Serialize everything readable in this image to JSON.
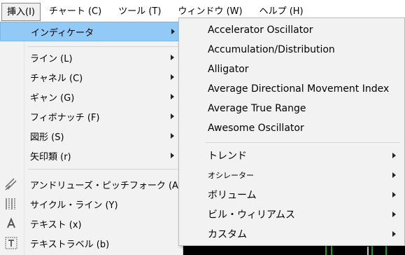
{
  "menubar": {
    "items": [
      {
        "label": "挿入(I)",
        "name": "menu-insert"
      },
      {
        "label": "チャート (C)",
        "name": "menu-chart"
      },
      {
        "label": "ツール (T)",
        "name": "menu-tools"
      },
      {
        "label": "ウィンドウ (W)",
        "name": "menu-window"
      },
      {
        "label": "ヘルプ (H)",
        "name": "menu-help"
      }
    ]
  },
  "insert_menu": {
    "indicators": "インディケータ",
    "items": [
      {
        "label": "ライン (L)"
      },
      {
        "label": "チャネル (C)"
      },
      {
        "label": "ギャン (G)"
      },
      {
        "label": "フィボナッチ (F)"
      },
      {
        "label": "図形 (S)"
      },
      {
        "label": "矢印類 (r)"
      }
    ],
    "tools": [
      {
        "label": "アンドリューズ・ピッチフォーク (A)",
        "icon": "pitchfork-icon"
      },
      {
        "label": "サイクル・ライン (Y)",
        "icon": "cycle-lines-icon"
      },
      {
        "label": "テキスト (x)",
        "icon": "text-icon"
      },
      {
        "label": "テキストラベル (b)",
        "icon": "text-label-icon"
      }
    ]
  },
  "indicators_submenu": {
    "items": [
      {
        "label": "Accelerator Oscillator"
      },
      {
        "label": "Accumulation/Distribution"
      },
      {
        "label": "Alligator"
      },
      {
        "label": "Average Directional Movement Index"
      },
      {
        "label": "Average True Range"
      },
      {
        "label": "Awesome Oscillator"
      }
    ],
    "categories": [
      {
        "label": "トレンド"
      },
      {
        "label": "オシレーター"
      },
      {
        "label": "ボリューム"
      },
      {
        "label": "ビル・ウィリアムス"
      },
      {
        "label": "カスタム"
      }
    ]
  },
  "colors": {
    "highlight": "#91c9f7",
    "menu_bg": "#f2f2f2",
    "chart_bar": "#18a018"
  }
}
